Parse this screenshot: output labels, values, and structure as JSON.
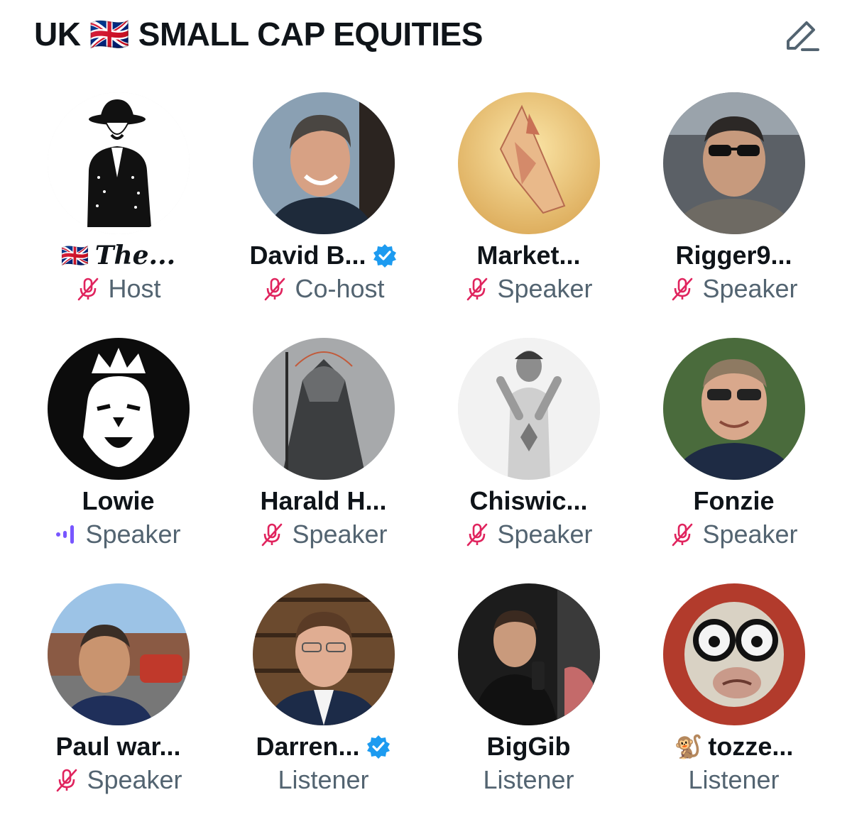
{
  "space": {
    "title": "UK 🇬🇧 SMALL CAP EQUITIES",
    "edit_icon": "edit-icon"
  },
  "colors": {
    "muted_mic": "#e0245e",
    "speaking": "#7856ff",
    "verified": "#1d9bf0",
    "role_text": "#536471"
  },
  "participants": [
    {
      "name": "The...",
      "prefix": "🇬🇧",
      "role": "Host",
      "status": "muted",
      "verified": false
    },
    {
      "name": "David B...",
      "prefix": "",
      "role": "Co-host",
      "status": "muted",
      "verified": true
    },
    {
      "name": "Market...",
      "prefix": "",
      "role": "Speaker",
      "status": "muted",
      "verified": false
    },
    {
      "name": "Rigger9...",
      "prefix": "",
      "role": "Speaker",
      "status": "muted",
      "verified": false
    },
    {
      "name": "Lowie",
      "prefix": "",
      "role": "Speaker",
      "status": "speaking",
      "verified": false
    },
    {
      "name": "Harald H...",
      "prefix": "",
      "role": "Speaker",
      "status": "muted",
      "verified": false
    },
    {
      "name": "Chiswic...",
      "prefix": "",
      "role": "Speaker",
      "status": "muted",
      "verified": false
    },
    {
      "name": "Fonzie",
      "prefix": "",
      "role": "Speaker",
      "status": "muted",
      "verified": false
    },
    {
      "name": "Paul war...",
      "prefix": "",
      "role": "Speaker",
      "status": "muted",
      "verified": false
    },
    {
      "name": "Darren...",
      "prefix": "",
      "role": "Listener",
      "status": "none",
      "verified": true
    },
    {
      "name": "BigGib",
      "prefix": "",
      "role": "Listener",
      "status": "none",
      "verified": false
    },
    {
      "name": "tozze...",
      "prefix": "🐒",
      "role": "Listener",
      "status": "none",
      "verified": false
    }
  ]
}
